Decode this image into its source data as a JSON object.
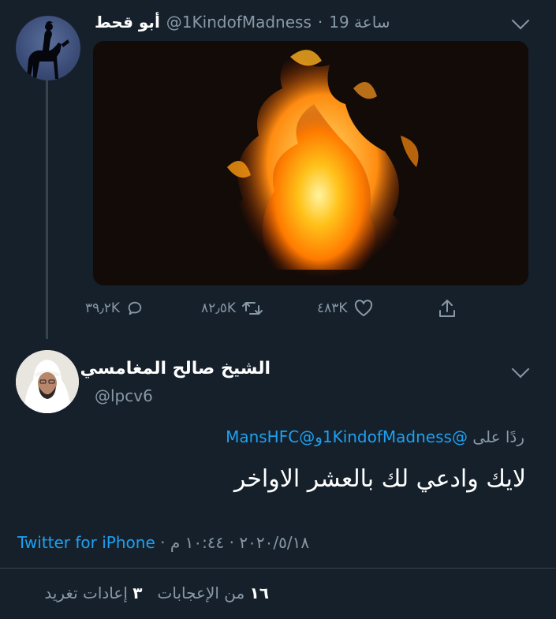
{
  "tweet1": {
    "name": "أبو قحط",
    "handle": "@1KindofMadness",
    "time": "19 ساعة",
    "actions": {
      "reply_count": "٣٩٫٢K",
      "retweet_count": "٨٢٫٥K",
      "like_count": "٤٨٣K"
    }
  },
  "tweet2": {
    "name": "الشيخ صالح المغامسي",
    "handle": "@lpcv6",
    "reply_prefix": "ردًا على",
    "reply_to_1": "@1KindofMadness",
    "reply_join": "و",
    "reply_to_2": "@MansHFC",
    "text": "لايك وادعي لك بالعشر الاواخر",
    "time": "١٠:٤٤ م",
    "date": "٢٠٢٠/٥/١٨",
    "source": "Twitter for iPhone",
    "separator": "·",
    "likes_count": "١٦",
    "likes_label": "من الإعجابات",
    "retweets_count": "٣",
    "retweets_label": "إعادات تغريد"
  },
  "colors": {
    "background": "#15202b",
    "link": "#1da1f2",
    "muted": "#8899a6"
  },
  "icons": [
    "chevron-down-icon",
    "reply-icon",
    "retweet-icon",
    "like-icon",
    "share-icon"
  ]
}
